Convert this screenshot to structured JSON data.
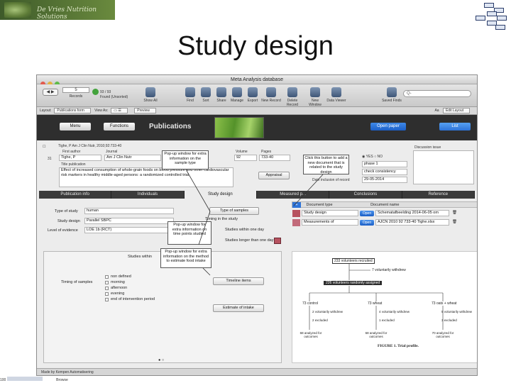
{
  "slide": {
    "logo_text": "De Vries Nutrition Solutions",
    "title": "Study design"
  },
  "window": {
    "title": "Meta Analysis database",
    "traffic_colors": [
      "#e25b4e",
      "#e3b340",
      "#5fbb49"
    ]
  },
  "toolbar": {
    "record_number": "5",
    "records_label": "Records",
    "found_count": "93 / 93",
    "found_status": "Found (Unsorted)",
    "show_all": "Show All",
    "items": [
      "Find",
      "Sort",
      "Share",
      "Manage",
      "Export",
      "New Record",
      "Delete Record",
      "New Window",
      "Data Viewer"
    ],
    "saved_finds": "Saved Finds",
    "search_placeholder": "Q-"
  },
  "layout_bar": {
    "layout_label": "Layout:",
    "layout_value": "Publications form",
    "view_as_label": "View As:",
    "preview": "Preview",
    "font_size": "Aa",
    "edit_layout": "Edit Layout"
  },
  "header": {
    "menu": "Menu",
    "functions": "Functions",
    "title": "Publications",
    "open_paper": "Open paper",
    "list": "List"
  },
  "record": {
    "citation": "Tighe, P Am J Clin Nutr, 2010;92:733-40",
    "first_author_label": "First author",
    "first_author": "Tighe, P",
    "journal_label": "Journal",
    "journal": "Am J Clin Nutr",
    "volume_label": "Volume",
    "volume": "92",
    "pages_label": "Pages",
    "pages": "733-40",
    "row_number": "31",
    "title_label": "Title publication",
    "title": "Effect of increased consumption of whole-grain foods on blood pressure and other cardiovascular risk markers in healthy middle-aged persons: a randomized controlled trial",
    "appraisal": "Appraisal",
    "yes_label": "YES",
    "no_label": "NO",
    "phase": "phase 1",
    "check_consistency": "check consistency",
    "date_label": "Date inclusion of record",
    "date": "29-05-2014",
    "discussion_label": "Discussion issue"
  },
  "tabs": [
    "Publication info",
    "Individuals",
    "Study design",
    "Measured p...",
    "Conclusions",
    "Reference"
  ],
  "active_tab": 2,
  "study": {
    "type_label": "Type of study",
    "type_value": "human",
    "design_label": "Study design",
    "design_value": "Parallel SBPC",
    "evidence_label": "Level of evidence",
    "evidence_value": "LOE 1b (RCT)",
    "type_of_samples": "Type of samples",
    "timing_label": "Timing in the study",
    "within_one_day": "Studies within one day",
    "longer_than_one_day": "Studies longer than one day",
    "studies_within": "Studies within",
    "timing_samples_label": "Timing of samples",
    "timing_options": [
      "non defined",
      "morning",
      "afternoon",
      "evening",
      "end of intervention period"
    ],
    "timeline_items": "Timeline items",
    "estimate_intake": "Estimate of intake"
  },
  "documents": {
    "plus": "+",
    "type_header": "Document type",
    "name_header": "Document name",
    "rows": [
      {
        "type": "Study design",
        "open": "Open",
        "name": "Schematafbeelding 2014-06-05 om",
        "color": "#b7525f"
      },
      {
        "type": "Measurements of",
        "open": "Open",
        "name": "AJCN 2010 92 733-40 Tighe.xlsx",
        "color": "#c26a7a"
      }
    ]
  },
  "flowchart": {
    "top_box": "233 volunteers recruited",
    "withdraw_top": "7 voluntarily withdrew",
    "randomized": "226 volunteers randomly assigned",
    "arms": [
      "73 control",
      "73 wheat",
      "73 oats + wheat"
    ],
    "withdraw_arms": [
      "2 voluntarily withdrew",
      "4 voluntarily withdrew",
      "5 voluntarily withdrew"
    ],
    "excluded": [
      "2 excluded",
      "1 excluded",
      "3 excluded"
    ],
    "analyzed": [
      "68 analyzed for outcomes",
      "68 analyzed for outcomes",
      "70 analyzed for outcomes"
    ],
    "caption": "FIGURE 1. Trial profile."
  },
  "callouts": {
    "sample_type": "Pop-up window for extra information on the sample type",
    "time_point": "Pop-up window for extra information on time points studied",
    "estimate": "Pop-up window for extra information on the method to estimate food intake",
    "add_document": "Click this button to add a new document that is related to the study design"
  },
  "footer": {
    "made_by": "Made by Kempen Automatisering",
    "zoom": "100",
    "mode": "Browse"
  }
}
